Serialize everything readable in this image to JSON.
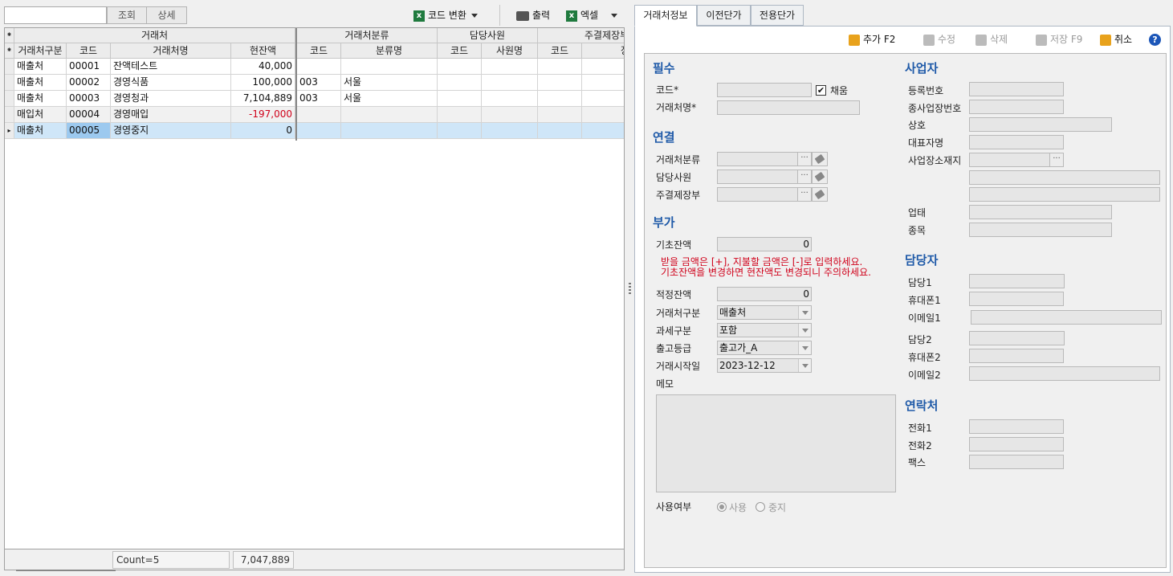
{
  "toolbar": {
    "search_value": "",
    "search_button": "조회",
    "detail_button": "상세",
    "code_convert": "코드 변환",
    "print": "출력",
    "excel": "엑셀"
  },
  "grid": {
    "group_headers": [
      "거래처",
      "거래처분류",
      "담당사원",
      "주결제장부"
    ],
    "columns": [
      "거래처구분",
      "코드",
      "거래처명",
      "현잔액",
      "코드",
      "분류명",
      "코드",
      "사원명",
      "코드",
      "장"
    ],
    "rows": [
      {
        "type": "매출처",
        "code": "00001",
        "name": "잔액테스트",
        "balance": "40,000",
        "cat_code": "",
        "cat_name": ""
      },
      {
        "type": "매출처",
        "code": "00002",
        "name": "경영식품",
        "balance": "100,000",
        "cat_code": "003",
        "cat_name": "서울"
      },
      {
        "type": "매출처",
        "code": "00003",
        "name": "경영청과",
        "balance": "7,104,889",
        "cat_code": "003",
        "cat_name": "서울"
      },
      {
        "type": "매입처",
        "code": "00004",
        "name": "경영매입",
        "balance": "-197,000",
        "cat_code": "",
        "cat_name": ""
      },
      {
        "type": "매출처",
        "code": "00005",
        "name": "경영중지",
        "balance": "0",
        "cat_code": "",
        "cat_name": ""
      }
    ],
    "footer_count": "Count=5",
    "footer_total": "7,047,889"
  },
  "tabs": [
    "거래처정보",
    "이전단가",
    "전용단가"
  ],
  "actions": {
    "add": "추가 F2",
    "edit": "수정",
    "delete": "삭제",
    "save": "저장 F9",
    "cancel": "취소",
    "help": "?"
  },
  "form": {
    "sec_required": "필수",
    "code_label": "코드*",
    "code_value": "",
    "auto_label": "채움",
    "auto_checked": "✔",
    "name_label": "거래처명*",
    "name_value": "",
    "sec_link": "연결",
    "category_label": "거래처분류",
    "staff_label": "담당사원",
    "ledger_label": "주결제장부",
    "dots": "···",
    "sec_extra": "부가",
    "initial_balance_label": "기초잔액",
    "initial_balance_value": "0",
    "warn_line1": "받을 금액은 [+], 지불할 금액은 [-]로 입력하세요.",
    "warn_line2": "기초잔액을 변경하면 현잔액도 변경되니 주의하세요.",
    "proper_balance_label": "적정잔액",
    "proper_balance_value": "0",
    "type_label": "거래처구분",
    "type_value": "매출처",
    "tax_label": "과세구분",
    "tax_value": "포함",
    "grade_label": "출고등급",
    "grade_value": "출고가_A",
    "start_label": "거래시작일",
    "start_value": "2023-12-12",
    "memo_label": "메모",
    "use_label": "사용여부",
    "use_on": "사용",
    "use_off": "중지"
  },
  "business": {
    "sec": "사업자",
    "reg_label": "등록번호",
    "sub_label": "종사업장번호",
    "company_label": "상호",
    "ceo_label": "대표자명",
    "addr_label": "사업장소재지",
    "biz_type_label": "업태",
    "biz_item_label": "종목"
  },
  "contact_person": {
    "sec": "담당자",
    "p1_label": "담당1",
    "m1_label": "휴대폰1",
    "e1_label": "이메일1",
    "p2_label": "담당2",
    "m2_label": "휴대폰2",
    "e2_label": "이메일2"
  },
  "contact": {
    "sec": "연락처",
    "tel1_label": "전화1",
    "tel2_label": "전화2",
    "fax_label": "팩스"
  },
  "colors": {
    "accent": "#1f5aa8",
    "negative": "#d0021b",
    "selection": "#cfe6f8"
  }
}
